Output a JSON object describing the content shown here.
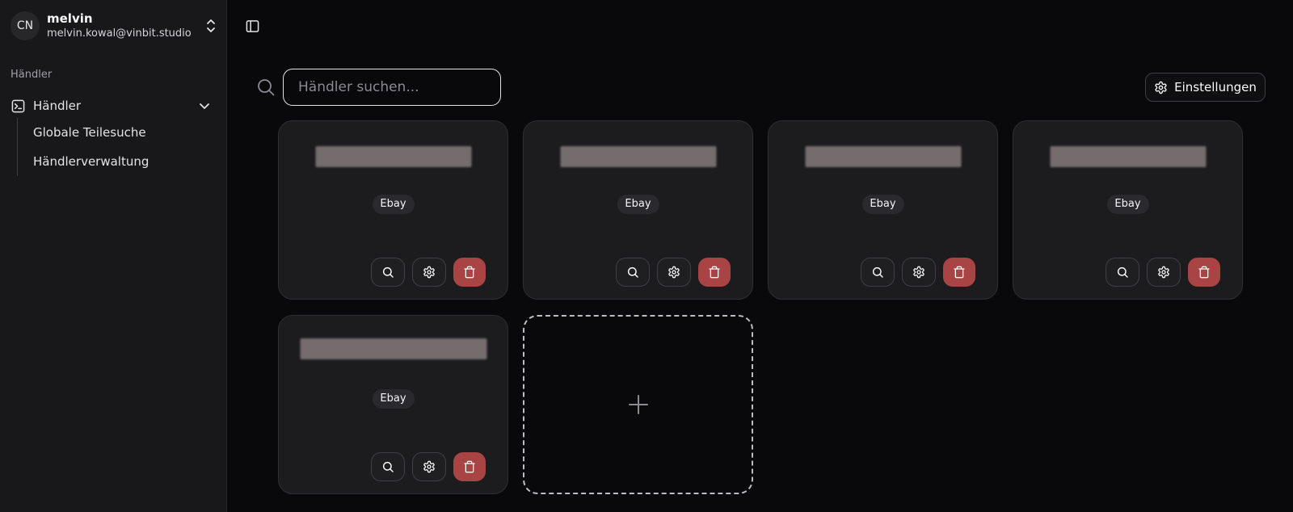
{
  "user": {
    "initials": "CN",
    "name": "melvin",
    "email": "melvin.kowal@vinbit.studio"
  },
  "sidebar": {
    "group_label": "Händler",
    "parent": {
      "label": "Händler",
      "icon": "terminal-square-icon",
      "expanded": true
    },
    "items": [
      {
        "label": "Globale Teilesuche"
      },
      {
        "label": "Händlerverwaltung"
      }
    ]
  },
  "search": {
    "placeholder": "Händler suchen...",
    "value": ""
  },
  "settings_button": {
    "label": "Einstellungen",
    "icon": "gear-icon"
  },
  "cards": [
    {
      "badge": "Ebay"
    },
    {
      "badge": "Ebay"
    },
    {
      "badge": "Ebay"
    },
    {
      "badge": "Ebay"
    },
    {
      "badge": "Ebay"
    }
  ],
  "colors": {
    "background": "#09090b",
    "sidebar": "#18181b",
    "card": "#1c1c1f",
    "danger": "#a84444",
    "redacted": "#756d6d"
  }
}
